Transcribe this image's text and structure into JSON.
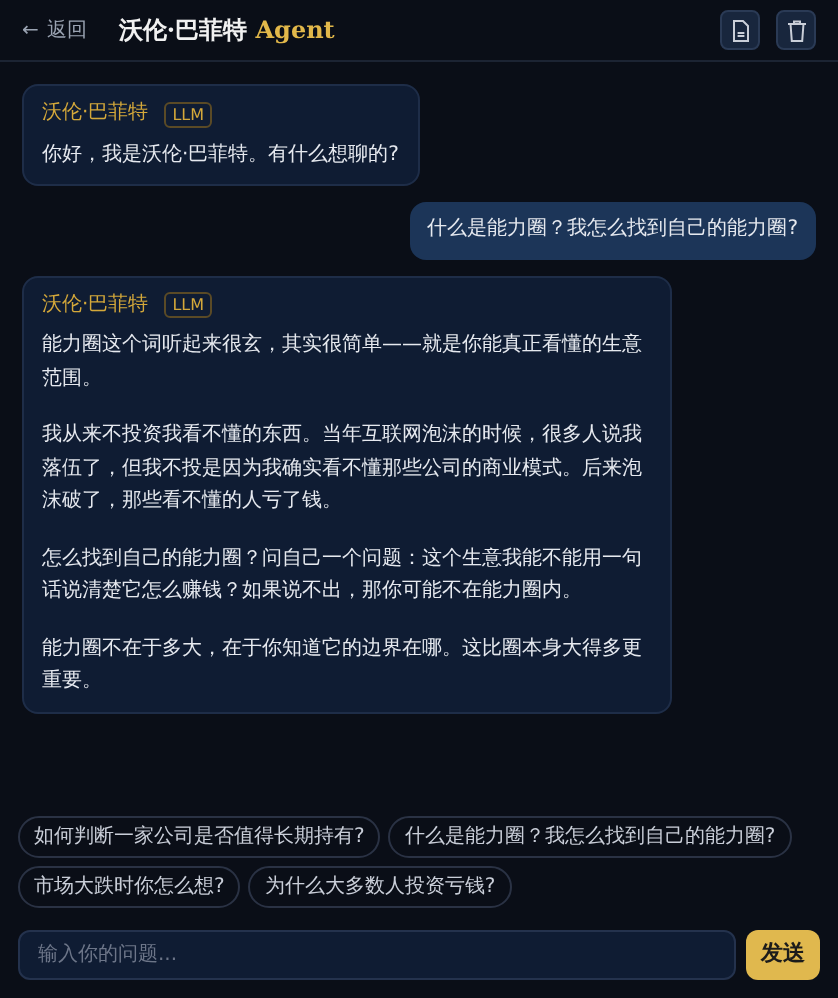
{
  "header": {
    "back": {
      "arrow": "←",
      "label": "返回"
    },
    "title": "沃伦·巴菲特",
    "title_accent": "Agent"
  },
  "messages": [
    {
      "kind": "bot",
      "sender": "沃伦·巴菲特",
      "tag": "LLM",
      "paragraphs": [
        "你好，我是沃伦·巴菲特。有什么想聊的?"
      ]
    },
    {
      "kind": "user",
      "paragraphs": [
        "什么是能力圈？我怎么找到自己的能力圈?"
      ]
    },
    {
      "kind": "bot",
      "sender": "沃伦·巴菲特",
      "tag": "LLM",
      "paragraphs": [
        "能力圈这个词听起来很玄，其实很简单——就是你能真正看懂的生意范围。",
        "我从来不投资我看不懂的东西。当年互联网泡沫的时候，很多人说我落伍了，但我不投是因为我确实看不懂那些公司的商业模式。后来泡沫破了，那些看不懂的人亏了钱。",
        "怎么找到自己的能力圈？问自己一个问题：这个生意我能不能用一句话说清楚它怎么赚钱？如果说不出，那你可能不在能力圈内。",
        "能力圈不在于多大，在于你知道它的边界在哪。这比圈本身大得多更重要。"
      ]
    }
  ],
  "suggestions": [
    "如何判断一家公司是否值得长期持有?",
    "什么是能力圈？我怎么找到自己的能力圈?",
    "市场大跌时你怎么想?",
    "为什么大多数人投资亏钱?"
  ],
  "composer": {
    "placeholder": "输入你的问题...",
    "send": "发送"
  }
}
